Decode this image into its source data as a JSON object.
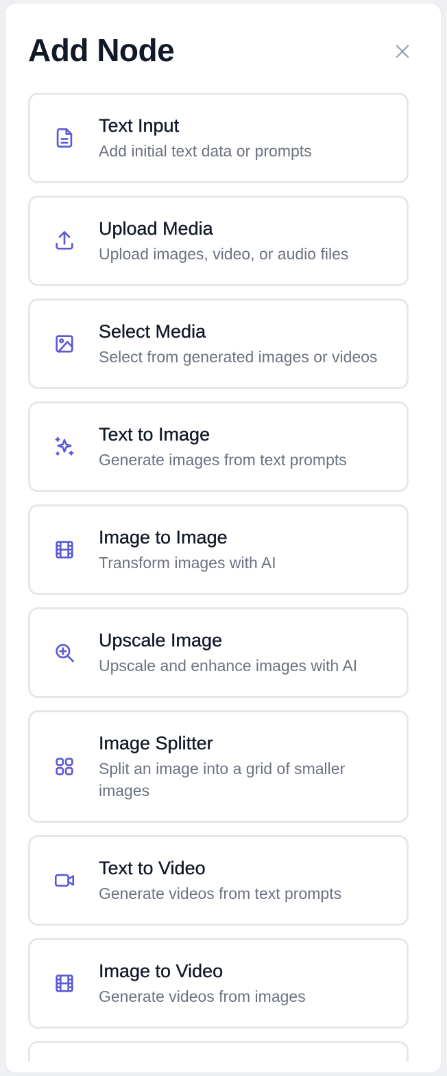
{
  "dialog": {
    "title": "Add Node"
  },
  "nodes": [
    {
      "title": "Text Input",
      "description": "Add initial text data or prompts",
      "icon": "file-text-icon"
    },
    {
      "title": "Upload Media",
      "description": "Upload images, video, or audio files",
      "icon": "upload-icon"
    },
    {
      "title": "Select Media",
      "description": "Select from generated images or videos",
      "icon": "image-icon"
    },
    {
      "title": "Text to Image",
      "description": "Generate images from text prompts",
      "icon": "sparkles-icon"
    },
    {
      "title": "Image to Image",
      "description": "Transform images with AI",
      "icon": "film-icon"
    },
    {
      "title": "Upscale Image",
      "description": "Upscale and enhance images with AI",
      "icon": "zoom-in-icon"
    },
    {
      "title": "Image Splitter",
      "description": "Split an image into a grid of smaller images",
      "icon": "grid-icon"
    },
    {
      "title": "Text to Video",
      "description": "Generate videos from text prompts",
      "icon": "video-icon"
    },
    {
      "title": "Image to Video",
      "description": "Generate videos from images",
      "icon": "film-icon"
    }
  ],
  "colors": {
    "accent": "#5b5bd6",
    "title": "#111827",
    "muted": "#6b7280",
    "border": "#e5e7eb"
  }
}
